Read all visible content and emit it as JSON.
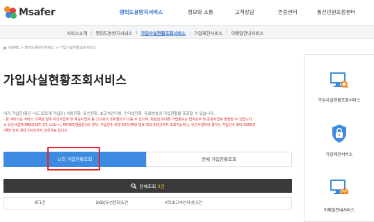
{
  "header": {
    "logo_text": "Msafer",
    "nav": [
      {
        "label": "명의도용방지서비스",
        "active": true
      },
      {
        "label": "정보와 소통",
        "active": false
      },
      {
        "label": "고객상담",
        "active": false
      },
      {
        "label": "인증센터",
        "active": false
      },
      {
        "label": "통신민원조정센터",
        "active": false
      }
    ]
  },
  "subnav": {
    "items": [
      {
        "label": "서비스소개",
        "active": false
      },
      {
        "label": "명의도용방지서비스",
        "active": false
      },
      {
        "label": "가입사실현황조회서비스",
        "active": true
      },
      {
        "label": "가입제한서비스",
        "active": false
      },
      {
        "label": "이메일안내서비스",
        "active": false
      }
    ]
  },
  "breadcrumb": "HOME > 명의도용방지서비스 > 가입사실현황조회서비스",
  "page_title": "가입사실현황조회서비스",
  "description": {
    "line1": "내가 가입한(혹은 나도 모르게 가입된) 이동전화, 유선전화, 초고속인터넷, 인터넷전화, 유료방송의 가입현황을 조회할 수 있습니다.",
    "notes": [
      "- 본 서비스는 서비스 지역설 일부 유선사업자 및 재공사업자 등 신고로의 조회결과가 다를 수 있으며, 회원님 유대폰 가입정보는 법적요무 및 운영사업로 발행될 수 있습니다.",
      "※ 유선사업자(MNO(SKT, KT, LGU+), MVNO(알뜰폰))의 경우, 가입한수 최대 50건(해당 번호 최대 50건)까지 조회가능하나, 유선사업자의 경우는 가입건수 최대 9999건",
      "(해당 번호 최대 50건)까지 조회가능 합니다."
    ]
  },
  "tabs": {
    "mine": "나의 가입현황조회",
    "all": "전체 가입현황조회"
  },
  "result": {
    "label": "전체조회",
    "count": "3건"
  },
  "carriers": [
    "KT1건",
    "SKB(유선전화)1건",
    "KT(초고속인터넷)1건",
    ""
  ],
  "sidebar": {
    "items": [
      {
        "label": "가입사실현황조회서비스",
        "icon": "monitor-search-icon"
      },
      {
        "label": "가입제한서비스",
        "icon": "lock-shield-icon"
      },
      {
        "label": "이메일안내서비스",
        "icon": "monitor-mail-icon"
      }
    ]
  },
  "colors": {
    "accent": "#2b6cc8",
    "tab_active": "#3d8be0",
    "highlight": "#e22222",
    "result_bar": "#3a3a3a",
    "count": "#f3c12b"
  }
}
